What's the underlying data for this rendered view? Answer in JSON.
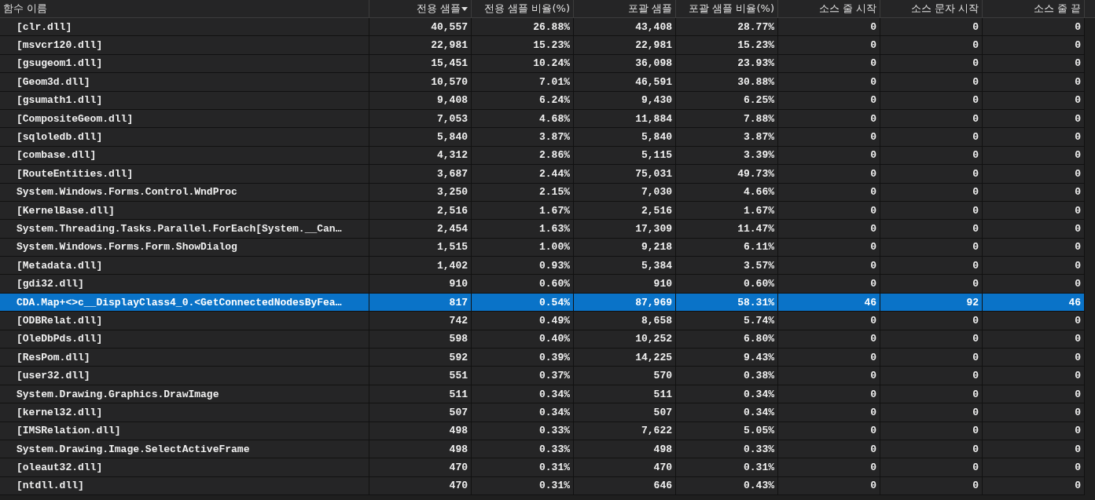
{
  "table": {
    "columns": [
      {
        "label": "함수 이름",
        "sorted": false
      },
      {
        "label": "전용 샘플",
        "sorted": true
      },
      {
        "label": "전용 샘플 비율(%)",
        "sorted": false
      },
      {
        "label": "포괄 샘플",
        "sorted": false
      },
      {
        "label": "포괄 샘플 비율(%)",
        "sorted": false
      },
      {
        "label": "소스 줄 시작",
        "sorted": false
      },
      {
        "label": "소스 문자 시작",
        "sorted": false
      },
      {
        "label": "소스 줄 끝",
        "sorted": false
      }
    ],
    "rows": [
      {
        "selected": false,
        "cells": [
          "[clr.dll]",
          "40,557",
          "26.88%",
          "43,408",
          "28.77%",
          "0",
          "0",
          "0"
        ]
      },
      {
        "selected": false,
        "cells": [
          "[msvcr120.dll]",
          "22,981",
          "15.23%",
          "22,981",
          "15.23%",
          "0",
          "0",
          "0"
        ]
      },
      {
        "selected": false,
        "cells": [
          "[gsugeom1.dll]",
          "15,451",
          "10.24%",
          "36,098",
          "23.93%",
          "0",
          "0",
          "0"
        ]
      },
      {
        "selected": false,
        "cells": [
          "[Geom3d.dll]",
          "10,570",
          "7.01%",
          "46,591",
          "30.88%",
          "0",
          "0",
          "0"
        ]
      },
      {
        "selected": false,
        "cells": [
          "[gsumath1.dll]",
          "9,408",
          "6.24%",
          "9,430",
          "6.25%",
          "0",
          "0",
          "0"
        ]
      },
      {
        "selected": false,
        "cells": [
          "[CompositeGeom.dll]",
          "7,053",
          "4.68%",
          "11,884",
          "7.88%",
          "0",
          "0",
          "0"
        ]
      },
      {
        "selected": false,
        "cells": [
          "[sqloledb.dll]",
          "5,840",
          "3.87%",
          "5,840",
          "3.87%",
          "0",
          "0",
          "0"
        ]
      },
      {
        "selected": false,
        "cells": [
          "[combase.dll]",
          "4,312",
          "2.86%",
          "5,115",
          "3.39%",
          "0",
          "0",
          "0"
        ]
      },
      {
        "selected": false,
        "cells": [
          "[RouteEntities.dll]",
          "3,687",
          "2.44%",
          "75,031",
          "49.73%",
          "0",
          "0",
          "0"
        ]
      },
      {
        "selected": false,
        "cells": [
          "System.Windows.Forms.Control.WndProc",
          "3,250",
          "2.15%",
          "7,030",
          "4.66%",
          "0",
          "0",
          "0"
        ]
      },
      {
        "selected": false,
        "cells": [
          "[KernelBase.dll]",
          "2,516",
          "1.67%",
          "2,516",
          "1.67%",
          "0",
          "0",
          "0"
        ]
      },
      {
        "selected": false,
        "cells": [
          "System.Threading.Tasks.Parallel.ForEach[System.__Can…",
          "2,454",
          "1.63%",
          "17,309",
          "11.47%",
          "0",
          "0",
          "0"
        ]
      },
      {
        "selected": false,
        "cells": [
          "System.Windows.Forms.Form.ShowDialog",
          "1,515",
          "1.00%",
          "9,218",
          "6.11%",
          "0",
          "0",
          "0"
        ]
      },
      {
        "selected": false,
        "cells": [
          "[Metadata.dll]",
          "1,402",
          "0.93%",
          "5,384",
          "3.57%",
          "0",
          "0",
          "0"
        ]
      },
      {
        "selected": false,
        "cells": [
          "[gdi32.dll]",
          "910",
          "0.60%",
          "910",
          "0.60%",
          "0",
          "0",
          "0"
        ]
      },
      {
        "selected": true,
        "cells": [
          "CDA.Map+<>c__DisplayClass4_0.<GetConnectedNodesByFea…",
          "817",
          "0.54%",
          "87,969",
          "58.31%",
          "46",
          "92",
          "46"
        ]
      },
      {
        "selected": false,
        "cells": [
          "[ODBRelat.dll]",
          "742",
          "0.49%",
          "8,658",
          "5.74%",
          "0",
          "0",
          "0"
        ]
      },
      {
        "selected": false,
        "cells": [
          "[OleDbPds.dll]",
          "598",
          "0.40%",
          "10,252",
          "6.80%",
          "0",
          "0",
          "0"
        ]
      },
      {
        "selected": false,
        "cells": [
          "[ResPom.dll]",
          "592",
          "0.39%",
          "14,225",
          "9.43%",
          "0",
          "0",
          "0"
        ]
      },
      {
        "selected": false,
        "cells": [
          "[user32.dll]",
          "551",
          "0.37%",
          "570",
          "0.38%",
          "0",
          "0",
          "0"
        ]
      },
      {
        "selected": false,
        "cells": [
          "System.Drawing.Graphics.DrawImage",
          "511",
          "0.34%",
          "511",
          "0.34%",
          "0",
          "0",
          "0"
        ]
      },
      {
        "selected": false,
        "cells": [
          "[kernel32.dll]",
          "507",
          "0.34%",
          "507",
          "0.34%",
          "0",
          "0",
          "0"
        ]
      },
      {
        "selected": false,
        "cells": [
          "[IMSRelation.dll]",
          "498",
          "0.33%",
          "7,622",
          "5.05%",
          "0",
          "0",
          "0"
        ]
      },
      {
        "selected": false,
        "cells": [
          "System.Drawing.Image.SelectActiveFrame",
          "498",
          "0.33%",
          "498",
          "0.33%",
          "0",
          "0",
          "0"
        ]
      },
      {
        "selected": false,
        "cells": [
          "[oleaut32.dll]",
          "470",
          "0.31%",
          "470",
          "0.31%",
          "0",
          "0",
          "0"
        ]
      },
      {
        "selected": false,
        "cells": [
          "[ntdll.dll]",
          "470",
          "0.31%",
          "646",
          "0.43%",
          "0",
          "0",
          "0"
        ]
      }
    ]
  }
}
